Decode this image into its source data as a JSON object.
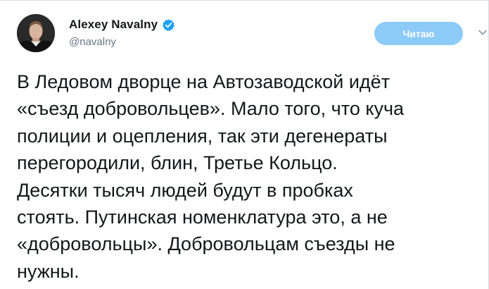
{
  "tweet": {
    "author": {
      "display_name": "Alexey Navalny",
      "handle": "@navalny",
      "verified_icon": "verified-badge-icon",
      "avatar": "profile-photo"
    },
    "follow_button_label": "Читаю",
    "menu_icon": "chevron-down-icon",
    "accent_color": "#8ccaf7",
    "verified_color": "#1da1f2",
    "text_lines": [
      "В Ледовом дворце на Автозаводской идёт",
      "«съезд добровольцев». Мало того, что куча",
      "полиции и оцепления, так эти дегенераты",
      "перегородили, блин, Третье Кольцо.",
      "Десятки тысяч людей будут в пробках",
      "стоять. Путинская номенклатура это, а не",
      "«добровольцы». Добровольцам съезды не",
      "нужны."
    ]
  }
}
